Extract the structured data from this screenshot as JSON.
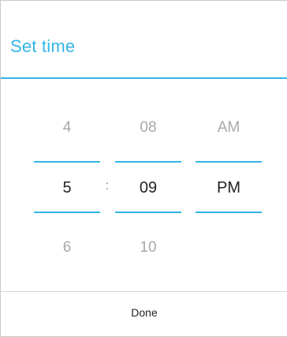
{
  "dialog": {
    "title": "Set time",
    "accent_color": "#33b5e5"
  },
  "picker": {
    "hours": {
      "prev": "4",
      "current": "5",
      "next": "6"
    },
    "separator": ":",
    "minutes": {
      "prev": "08",
      "current": "09",
      "next": "10"
    },
    "ampm": {
      "prev": "AM",
      "current": "PM",
      "next": ""
    }
  },
  "actions": {
    "done_label": "Done"
  }
}
